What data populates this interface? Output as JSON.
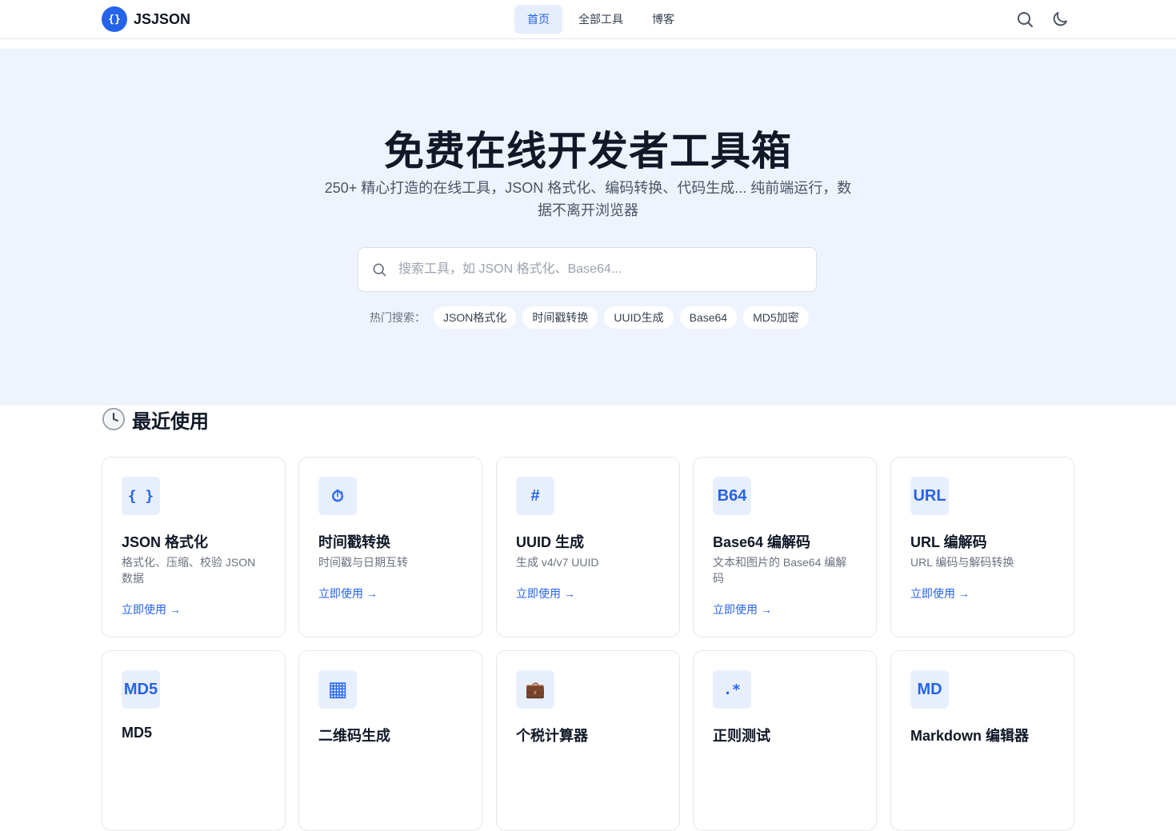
{
  "header": {
    "brand_logo": "{}",
    "brand_name": "JSJSON",
    "nav": [
      "首页",
      "全部工具",
      "博客"
    ],
    "icons": [
      "search-icon",
      "moon-icon"
    ]
  },
  "hero": {
    "title": "免费在线开发者工具箱",
    "subtitle": "250+ 精心打造的在线工具，JSON 格式化、编码转换、代码生成... 纯前端运行，数据不离开浏览器",
    "search_placeholder": "搜索工具，如 JSON 格式化、Base64...",
    "hot_label": "热门搜索：",
    "hot_tags": [
      "JSON格式化",
      "时间戳转换",
      "UUID生成",
      "Base64",
      "MD5加密"
    ]
  },
  "recent": {
    "title": "最近使用",
    "icon": "clock-icon",
    "cards": [
      {
        "icon": "{ }",
        "title": "JSON 格式化",
        "desc": "格式化、压缩、校验 JSON 数据",
        "link": "立即使用 →"
      },
      {
        "icon": "⏱",
        "title": "时间戳转换",
        "desc": "时间戳与日期互转",
        "link": "立即使用 →"
      },
      {
        "icon": "#",
        "title": "UUID 生成",
        "desc": "生成 v4/v7 UUID",
        "link": "立即使用 →"
      },
      {
        "icon": "B64",
        "title": "Base64 编解码",
        "desc": "文本和图片的 Base64 编解码",
        "link": "立即使用 →"
      },
      {
        "icon": "URL",
        "title": "URL 编解码",
        "desc": "URL 编码与解码转换",
        "link": "立即使用 →"
      },
      {
        "icon": "MD5",
        "title": "MD5",
        "desc": "",
        "link": ""
      },
      {
        "icon": "▦",
        "title": "二维码生成",
        "desc": "",
        "link": ""
      },
      {
        "icon": "💼",
        "title": "个税计算器",
        "desc": "",
        "link": ""
      },
      {
        "icon": ".*",
        "title": "正则测试",
        "desc": "",
        "link": ""
      },
      {
        "icon": "MD",
        "title": "Markdown 编辑器",
        "desc": "",
        "link": ""
      }
    ]
  },
  "colors": {
    "accent": "#2563eb",
    "hero_bg": "#eef3fd",
    "icon_bg": "#e8effc"
  }
}
